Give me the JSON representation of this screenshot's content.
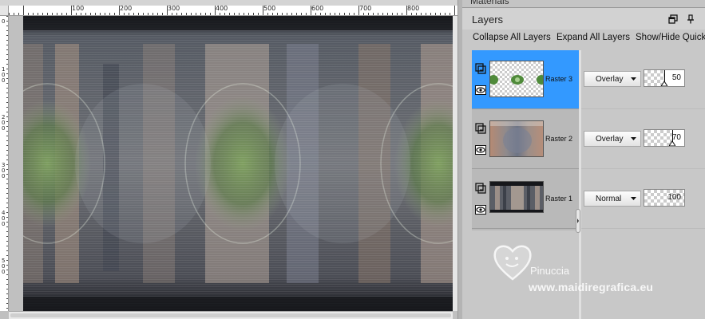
{
  "canvas": {
    "top_ruler_labels": [
      "100",
      "200",
      "300",
      "400",
      "500",
      "600",
      "700",
      "800"
    ],
    "left_ruler_labels": [
      "0",
      "1\n0\n0",
      "2\n0\n0",
      "3\n0\n0",
      "4\n0\n0",
      "5\n0\n0"
    ]
  },
  "materials": {
    "title": "Materials"
  },
  "layers_panel": {
    "title": "Layers",
    "toolbar": {
      "collapse_all": "Collapse All Layers",
      "expand_all": "Expand All Layers",
      "show_hide": "Show/Hide Quick"
    },
    "layers": [
      {
        "name": "Raster 3",
        "blend_mode": "Overlay",
        "opacity": "50",
        "opacity_fraction": 0.5,
        "selected": true
      },
      {
        "name": "Raster 2",
        "blend_mode": "Overlay",
        "opacity": "70",
        "opacity_fraction": 0.7,
        "selected": false
      },
      {
        "name": "Raster 1",
        "blend_mode": "Normal",
        "opacity": "100",
        "opacity_fraction": 1.0,
        "selected": false
      }
    ]
  },
  "watermark": {
    "name": "Pinuccia",
    "site": "www.maidiregrafica.eu"
  },
  "colors": {
    "selected_layer": "#3399ff",
    "panel_bg": "#c8c8c8"
  },
  "icons": [
    "float-icon",
    "pin-icon",
    "layer-group-icon",
    "visibility-eye-icon",
    "chevron-down-icon",
    "heart-logo-icon"
  ]
}
